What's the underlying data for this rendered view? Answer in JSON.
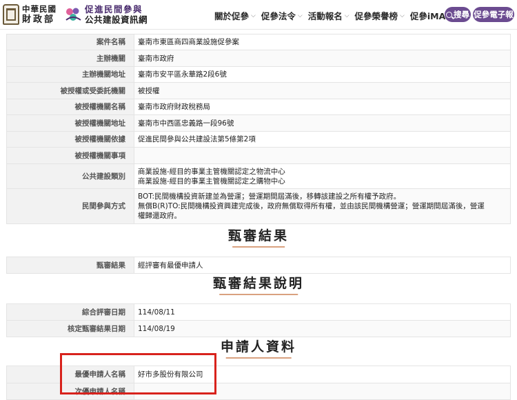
{
  "header": {
    "mof_logo": {
      "line1": "中華民國",
      "line2": "財政部"
    },
    "ppp_logo": {
      "line1": "促進民間參與",
      "line2": "公共建設資訊網"
    },
    "nav": [
      {
        "label": "關於促參"
      },
      {
        "label": "促參法令"
      },
      {
        "label": "活動報名"
      },
      {
        "label": "促參榮譽榜"
      },
      {
        "label": "促參iMAP"
      }
    ],
    "search_label": "搜尋",
    "ebook_label": "促參電子報"
  },
  "case_info": [
    {
      "label": "案件名稱",
      "value": "臺南市東區商四商業設施促參案"
    },
    {
      "label": "主辦機關",
      "value": "臺南市政府"
    },
    {
      "label": "主辦機關地址",
      "value": "臺南市安平區永華路2段6號"
    },
    {
      "label": "被授權或受委託機關",
      "value": "被授權"
    },
    {
      "label": "被授權機關名稱",
      "value": "臺南市政府財政稅務局"
    },
    {
      "label": "被授權機關地址",
      "value": "臺南市中西區忠義路一段96號"
    },
    {
      "label": "被授權機關依據",
      "value": "促進民間參與公共建設法第5條第2項"
    },
    {
      "label": "被授權機關事項",
      "value": ""
    },
    {
      "label": "公共建設類別",
      "lines": [
        "商業設施-經目的事業主管機關認定之物流中心",
        "商業設施-經目的事業主管機關認定之購物中心"
      ]
    },
    {
      "label": "民間參與方式",
      "lines": [
        "BOT:民間機構投資新建並為營運；營運期間屆滿後，移轉該建設之所有權予政府。",
        "無償B(R)TO:民間機構投資興建完成後，政府無償取得所有權，並由該民間機構營運；營運期間屆滿後，營運",
        "權歸還政府。"
      ]
    }
  ],
  "section_review": {
    "title": "甄審結果",
    "rows": [
      {
        "label": "甄審結果",
        "value": "經評審有最優申請人"
      }
    ]
  },
  "section_review_desc": {
    "title": "甄審結果說明",
    "rows": [
      {
        "label": "綜合評審日期",
        "value": "114/08/11"
      },
      {
        "label": "核定甄審結果日期",
        "value": "114/08/19"
      }
    ]
  },
  "section_applicant": {
    "title": "申請人資料",
    "rows": [
      {
        "label": "最優申請人名稱",
        "value": "好市多股份有限公司"
      },
      {
        "label": "次優申請人名稱",
        "value": ""
      }
    ]
  },
  "colors": {
    "brand_purple": "#6b4b90",
    "highlight_red": "#d8221c",
    "title_underline": "#d9a17f"
  }
}
